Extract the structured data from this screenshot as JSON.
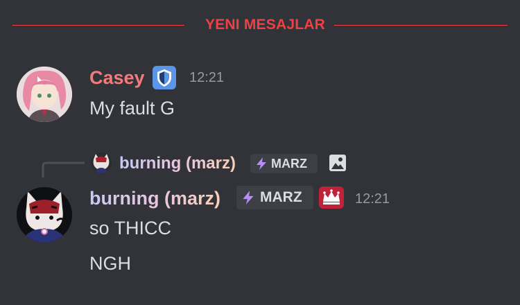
{
  "divider": {
    "label": "YENI MESAJLAR",
    "color": "#f23f43"
  },
  "messages": [
    {
      "author": "Casey",
      "author_color": "#f47b7b",
      "badge_icon": "shield-icon",
      "time": "12:21",
      "lines": [
        "My fault G"
      ]
    },
    {
      "reply": {
        "author": "burning (marz)",
        "tag": "MARZ",
        "attachment_icon": "image-icon"
      },
      "author": "burning (marz)",
      "tag": "MARZ",
      "tag_icon": "lightning-icon",
      "role_icon": "crown-icon",
      "time": "12:21",
      "lines": [
        "so THICC",
        "NGH"
      ]
    }
  ]
}
